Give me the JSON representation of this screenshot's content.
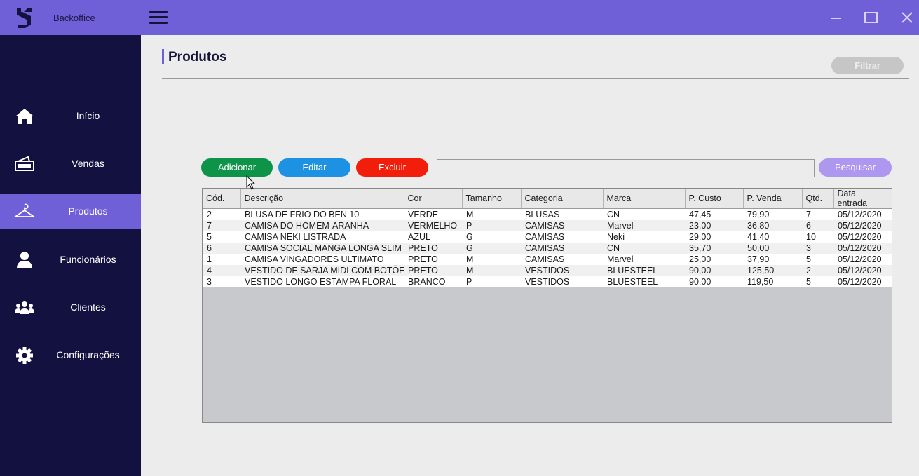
{
  "app": {
    "title": "Backoffice"
  },
  "colors": {
    "accent": "#7060d8",
    "sidebar_bg": "#13113f",
    "add": "#0e9448",
    "edit": "#1e92e2",
    "delete": "#f01e0a",
    "search": "#ae98ef"
  },
  "sidebar": {
    "items": [
      {
        "label": "Início",
        "icon": "home-icon",
        "active": false
      },
      {
        "label": "Vendas",
        "icon": "cash-register-icon",
        "active": false
      },
      {
        "label": "Produtos",
        "icon": "hanger-icon",
        "active": true
      },
      {
        "label": "Funcionários",
        "icon": "user-icon",
        "active": false
      },
      {
        "label": "Clientes",
        "icon": "users-icon",
        "active": false
      },
      {
        "label": "Configurações",
        "icon": "gear-icon",
        "active": false
      }
    ]
  },
  "page": {
    "title": "Produtos",
    "filter_label": "Filtrar"
  },
  "toolbar": {
    "add_label": "Adicionar",
    "edit_label": "Editar",
    "delete_label": "Excluir",
    "search_value": "",
    "search_label": "Pesquisar"
  },
  "table": {
    "columns": [
      "Cód.",
      "Descrição",
      "Cor",
      "Tamanho",
      "Categoria",
      "Marca",
      "P. Custo",
      "P. Venda",
      "Qtd.",
      "Data entrada"
    ],
    "rows": [
      [
        "2",
        "BLUSA DE FRIO DO BEN 10",
        "VERDE",
        "M",
        "BLUSAS",
        "CN",
        "47,45",
        "79,90",
        "7",
        "05/12/2020"
      ],
      [
        "7",
        "CAMISA DO HOMEM-ARANHA",
        "VERMELHO",
        "P",
        "CAMISAS",
        "Marvel",
        "23,00",
        "36,80",
        "6",
        "05/12/2020"
      ],
      [
        "5",
        "CAMISA NEKI LISTRADA",
        "AZUL",
        "G",
        "CAMISAS",
        "Neki",
        "29,00",
        "41,40",
        "10",
        "05/12/2020"
      ],
      [
        "6",
        "CAMISA SOCIAL MANGA LONGA SLIM",
        "PRETO",
        "G",
        "CAMISAS",
        "CN",
        "35,70",
        "50,00",
        "3",
        "05/12/2020"
      ],
      [
        "1",
        "CAMISA VINGADORES ULTIMATO",
        "PRETO",
        "M",
        "CAMISAS",
        "Marvel",
        "25,00",
        "37,90",
        "5",
        "05/12/2020"
      ],
      [
        "4",
        "VESTIDO DE SARJA MIDI COM BOTÕES",
        "PRETO",
        "M",
        "VESTIDOS",
        "BLUESTEEL",
        "90,00",
        "125,50",
        "2",
        "05/12/2020"
      ],
      [
        "3",
        "VESTIDO LONGO ESTAMPA FLORAL",
        "BRANCO",
        "P",
        "VESTIDOS",
        "BLUESTEEL",
        "90,00",
        "119,50",
        "5",
        "05/12/2020"
      ]
    ]
  }
}
